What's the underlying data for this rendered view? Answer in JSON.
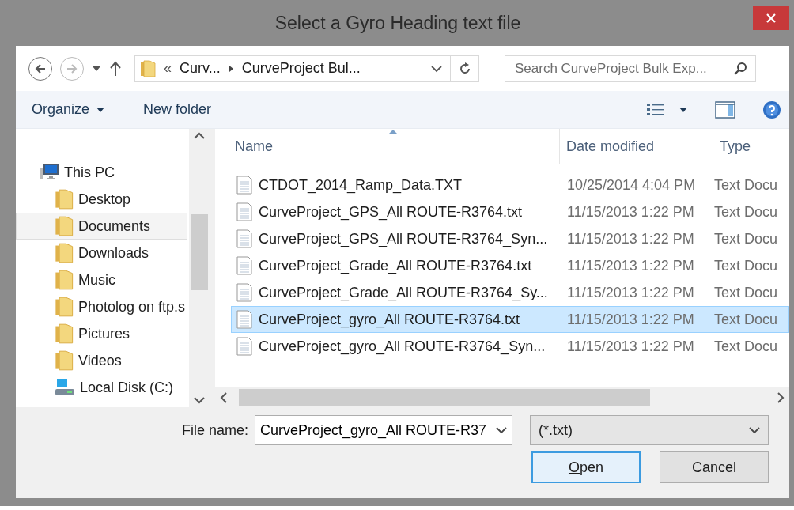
{
  "window": {
    "title": "Select a Gyro Heading text file"
  },
  "address": {
    "overflow": "«",
    "crumbs": [
      "Curv...",
      "CurveProject Bul..."
    ]
  },
  "search": {
    "placeholder": "Search CurveProject Bulk Exp..."
  },
  "toolbar": {
    "organize": "Organize",
    "new_folder": "New folder"
  },
  "sidebar": {
    "items": [
      {
        "label": "This PC",
        "kind": "pc",
        "selected": false,
        "children": [
          {
            "label": "Desktop",
            "kind": "folder",
            "selected": false
          },
          {
            "label": "Documents",
            "kind": "folder",
            "selected": true
          },
          {
            "label": "Downloads",
            "kind": "folder",
            "selected": false
          },
          {
            "label": "Music",
            "kind": "folder",
            "selected": false
          },
          {
            "label": "Photolog on ftp.s",
            "kind": "folder",
            "selected": false
          },
          {
            "label": "Pictures",
            "kind": "folder",
            "selected": false
          },
          {
            "label": "Videos",
            "kind": "folder",
            "selected": false
          },
          {
            "label": "Local Disk (C:)",
            "kind": "drive",
            "selected": false
          }
        ]
      }
    ]
  },
  "table": {
    "columns": [
      "Name",
      "Date modified",
      "Type"
    ],
    "rows": [
      {
        "name": "CTDOT_2014_Ramp_Data.TXT",
        "date": "10/25/2014 4:04 PM",
        "type": "Text Docu",
        "selected": false
      },
      {
        "name": "CurveProject_GPS_All ROUTE-R3764.txt",
        "date": "11/15/2013 1:22 PM",
        "type": "Text Docu",
        "selected": false
      },
      {
        "name": "CurveProject_GPS_All ROUTE-R3764_Syn...",
        "date": "11/15/2013 1:22 PM",
        "type": "Text Docu",
        "selected": false
      },
      {
        "name": "CurveProject_Grade_All ROUTE-R3764.txt",
        "date": "11/15/2013 1:22 PM",
        "type": "Text Docu",
        "selected": false
      },
      {
        "name": "CurveProject_Grade_All ROUTE-R3764_Sy...",
        "date": "11/15/2013 1:22 PM",
        "type": "Text Docu",
        "selected": false
      },
      {
        "name": "CurveProject_gyro_All ROUTE-R3764.txt",
        "date": "11/15/2013 1:22 PM",
        "type": "Text Docu",
        "selected": true
      },
      {
        "name": "CurveProject_gyro_All ROUTE-R3764_Syn...",
        "date": "11/15/2013 1:22 PM",
        "type": "Text Docu",
        "selected": false
      }
    ]
  },
  "file_name": {
    "label_start": "File ",
    "access_key": "n",
    "label_end": "ame:",
    "value": "CurveProject_gyro_All ROUTE-R37"
  },
  "file_type": {
    "value": "(*.txt)"
  },
  "buttons": [
    {
      "access_key": "O",
      "label_end": "pen",
      "default": true
    },
    {
      "label_start": "Cancel",
      "default": false
    }
  ]
}
